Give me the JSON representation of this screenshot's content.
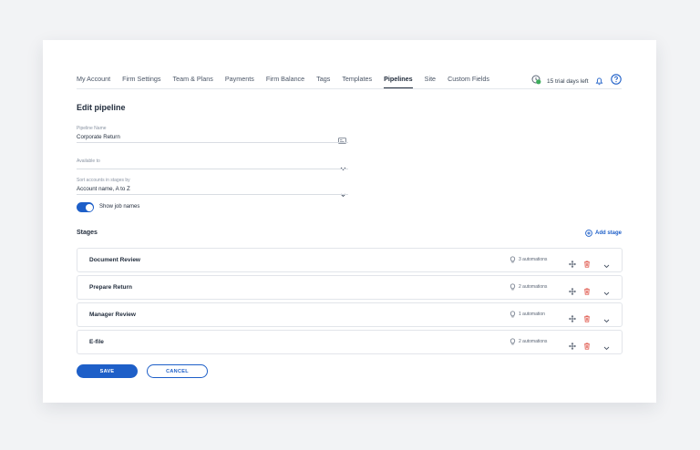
{
  "nav": {
    "items": [
      "My Account",
      "Firm Settings",
      "Team & Plans",
      "Payments",
      "Firm Balance",
      "Tags",
      "Templates",
      "Pipelines",
      "Site",
      "Custom Fields"
    ],
    "active": "Pipelines"
  },
  "trial": {
    "text": "15 trial days left"
  },
  "page": {
    "title": "Edit pipeline"
  },
  "form": {
    "pipeline_name": {
      "label": "Pipeline Name",
      "value": "Corporate Return"
    },
    "available_to": {
      "label": "Available to",
      "value": ""
    },
    "sort": {
      "label": "Sort accounts in stages by",
      "value": "Account name, A to Z"
    },
    "show_job_names": {
      "label": "Show job names",
      "enabled": true
    }
  },
  "stages": {
    "heading": "Stages",
    "add_label": "Add stage",
    "items": [
      {
        "name": "Document Review",
        "automations": "3 automations"
      },
      {
        "name": "Prepare Return",
        "automations": "2 automations"
      },
      {
        "name": "Manager Review",
        "automations": "1 automation"
      },
      {
        "name": "E-file",
        "automations": "2 automations"
      }
    ]
  },
  "buttons": {
    "save": "SAVE",
    "cancel": "CANCEL"
  },
  "colors": {
    "accent": "#1e5fc8",
    "delete": "#e05a4f",
    "text": "#1f2a3a"
  }
}
